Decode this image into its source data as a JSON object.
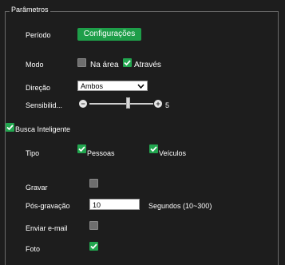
{
  "section": {
    "title": "Parâmetros"
  },
  "periodo": {
    "label": "Período",
    "button_label": "Configurações"
  },
  "modo": {
    "label": "Modo",
    "option_area": "Na área",
    "option_atraves": "Através",
    "area_checked": false,
    "atraves_checked": true
  },
  "direcao": {
    "label": "Direção",
    "selected": "Ambos"
  },
  "sensibilidade": {
    "label": "Sensibilid...",
    "value": "5",
    "level_fraction": 0.6
  },
  "busca": {
    "label": "Busca Inteligente",
    "checked": true
  },
  "tipo": {
    "label": "Tipo",
    "pessoas": "Pessoas",
    "veiculos": "Veículos",
    "pessoas_checked": true,
    "veiculos_checked": true
  },
  "gravar": {
    "label": "Gravar",
    "checked": false
  },
  "pos_gravacao": {
    "label": "Pós-gravação",
    "value": "10",
    "unit": "Segundos (10~300)"
  },
  "email": {
    "label": "Enviar e-mail",
    "checked": false
  },
  "foto": {
    "label": "Foto",
    "checked": true
  },
  "colors": {
    "accent": "#1e9e49",
    "background": "#1d1d1d",
    "border": "#6a6a6a"
  }
}
